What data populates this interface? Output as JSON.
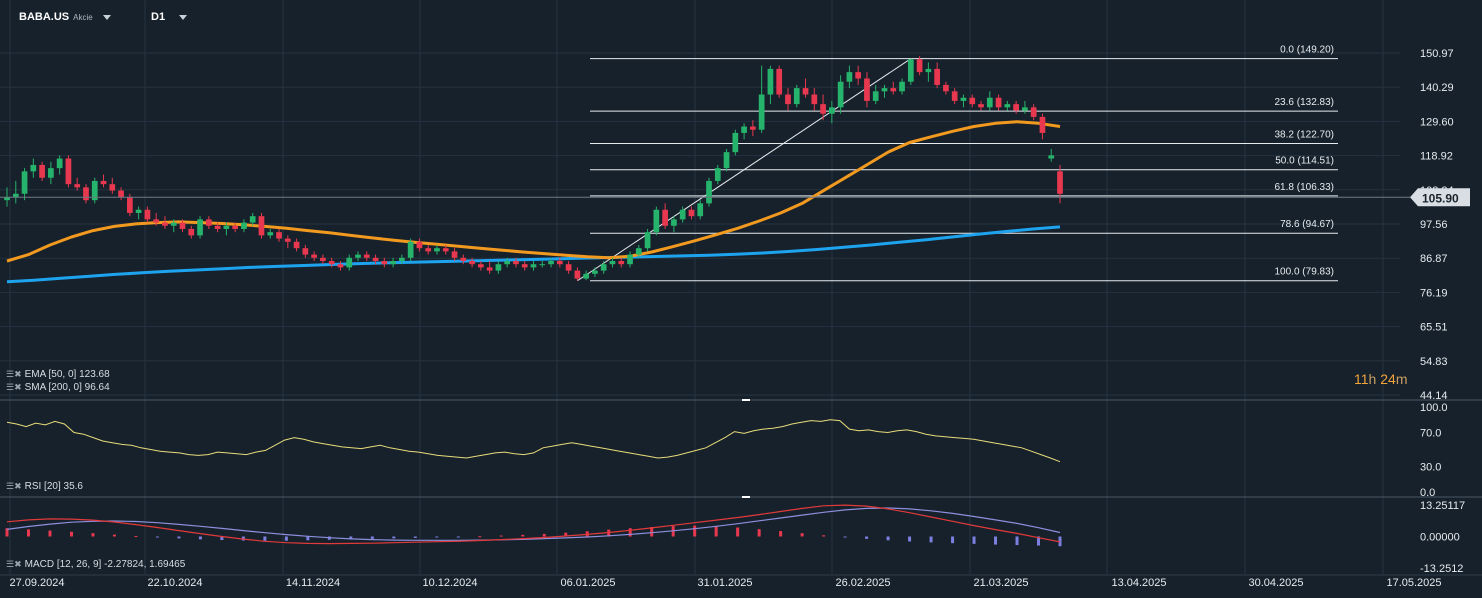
{
  "header": {
    "symbol": "BABA.US",
    "symbol_type": "Akcie",
    "timeframe": "D1"
  },
  "indicators": {
    "ema_label": "EMA [50, 0] 123.68",
    "sma_label": "SMA [200, 0] 96.64",
    "rsi_label": "RSI [20] 35.6",
    "macd_label": "MACD [12, 26, 9] -2.27824, 1.69465"
  },
  "countdown": {
    "hours": "11",
    "h_unit": "h",
    "minutes": "24",
    "m_unit": "m"
  },
  "colors": {
    "background": "#17212b",
    "grid": "#243240",
    "up_candle": "#26b36b",
    "down_candle": "#e8384f",
    "ema": "#f29a1f",
    "sma": "#1ea3ee",
    "rsi": "#e8dc7a",
    "macd_line": "#e23a3a",
    "signal_line": "#8c8fdd",
    "hist_pos": "#e8384f",
    "hist_neg": "#7b7fe0",
    "price_tag": "#d8dee3",
    "countdown": "#f2a33a"
  },
  "chart_data": [
    {
      "type": "candlestick",
      "price_axis_ticks": [
        "150.97",
        "140.29",
        "129.60",
        "118.92",
        "108.24",
        "97.56",
        "86.87",
        "76.19",
        "65.51",
        "54.83",
        "44.14"
      ],
      "ylim": [
        44.14,
        150.97
      ],
      "current_price": "105.90",
      "date_ticks": [
        "27.09.2024",
        "22.10.2024",
        "14.11.2024",
        "10.12.2024",
        "06.01.2025",
        "31.01.2025",
        "26.02.2025",
        "21.03.2025",
        "13.04.2025",
        "30.04.2025",
        "17.05.2025"
      ],
      "candles": [
        [
          105,
          109,
          103,
          106
        ],
        [
          106,
          111,
          104,
          107
        ],
        [
          107,
          115,
          105,
          114
        ],
        [
          114,
          118,
          112,
          116
        ],
        [
          116,
          117,
          111,
          112
        ],
        [
          112,
          117,
          110,
          115
        ],
        [
          115,
          119,
          113,
          118
        ],
        [
          118,
          119,
          109,
          110
        ],
        [
          110,
          112,
          108,
          109
        ],
        [
          109,
          110,
          104,
          105
        ],
        [
          105,
          112,
          104,
          111
        ],
        [
          111,
          113,
          109,
          110
        ],
        [
          110,
          112,
          107,
          108
        ],
        [
          108,
          109,
          105,
          106
        ],
        [
          106,
          107,
          100,
          101
        ],
        [
          101,
          103,
          99,
          102
        ],
        [
          102,
          103,
          98,
          99
        ],
        [
          99,
          101,
          97,
          98
        ],
        [
          98,
          100,
          96,
          97
        ],
        [
          97,
          99,
          95,
          98
        ],
        [
          98,
          99,
          95,
          96
        ],
        [
          96,
          97,
          93,
          94
        ],
        [
          94,
          100,
          93,
          99
        ],
        [
          99,
          100,
          96,
          97
        ],
        [
          97,
          98,
          95,
          96
        ],
        [
          96,
          98,
          94,
          97
        ],
        [
          97,
          98,
          95,
          96
        ],
        [
          96,
          99,
          95,
          98
        ],
        [
          98,
          101,
          97,
          100
        ],
        [
          100,
          101,
          93,
          94
        ],
        [
          94,
          96,
          93,
          95
        ],
        [
          95,
          96,
          92,
          93
        ],
        [
          93,
          94,
          90,
          92
        ],
        [
          92,
          93,
          89,
          90
        ],
        [
          90,
          91,
          87,
          88
        ],
        [
          88,
          89,
          86,
          87
        ],
        [
          87,
          88,
          85,
          86
        ],
        [
          86,
          87,
          84,
          85
        ],
        [
          85,
          86,
          83,
          84
        ],
        [
          84,
          88,
          83,
          87
        ],
        [
          87,
          89,
          86,
          88
        ],
        [
          88,
          89,
          86,
          87
        ],
        [
          87,
          88,
          85,
          86
        ],
        [
          86,
          87,
          84,
          85
        ],
        [
          85,
          87,
          84,
          86
        ],
        [
          86,
          88,
          85,
          87
        ],
        [
          87,
          93,
          86,
          92
        ],
        [
          92,
          93,
          89,
          90
        ],
        [
          90,
          91,
          88,
          89
        ],
        [
          89,
          91,
          88,
          90
        ],
        [
          90,
          91,
          88,
          89
        ],
        [
          89,
          90,
          86,
          87
        ],
        [
          87,
          88,
          85,
          86
        ],
        [
          86,
          87,
          84,
          85
        ],
        [
          85,
          86,
          83,
          84
        ],
        [
          84,
          86,
          82,
          83
        ],
        [
          83,
          86,
          82,
          85
        ],
        [
          85,
          87,
          84,
          86
        ],
        [
          86,
          87,
          84,
          85
        ],
        [
          85,
          86,
          83,
          84
        ],
        [
          84,
          86,
          83,
          85
        ],
        [
          85,
          86,
          84,
          85
        ],
        [
          85,
          87,
          84,
          86
        ],
        [
          86,
          87,
          84,
          85
        ],
        [
          85,
          86,
          82,
          83
        ],
        [
          83,
          84,
          79.83,
          80.5
        ],
        [
          80.5,
          83,
          80,
          82
        ],
        [
          82,
          84,
          81,
          83
        ],
        [
          83,
          86,
          82,
          85
        ],
        [
          85,
          87,
          84,
          86
        ],
        [
          86,
          87,
          84,
          85
        ],
        [
          85,
          89,
          84,
          88
        ],
        [
          88,
          91,
          87,
          90
        ],
        [
          90,
          96,
          89,
          95
        ],
        [
          95,
          103,
          94,
          102
        ],
        [
          102,
          104,
          96,
          97
        ],
        [
          97,
          100,
          95,
          99
        ],
        [
          99,
          103,
          98,
          102
        ],
        [
          102,
          103,
          99,
          100
        ],
        [
          100,
          105,
          99,
          104
        ],
        [
          104,
          112,
          103,
          111
        ],
        [
          111,
          116,
          110,
          115
        ],
        [
          115,
          121,
          114,
          120
        ],
        [
          120,
          127,
          119,
          126
        ],
        [
          126,
          129,
          124,
          128
        ],
        [
          128,
          130,
          125,
          127
        ],
        [
          127,
          147,
          126,
          138
        ],
        [
          138,
          147,
          135,
          146
        ],
        [
          146,
          147,
          137,
          138
        ],
        [
          138,
          140,
          133,
          135
        ],
        [
          135,
          141,
          134,
          140
        ],
        [
          140,
          143,
          137,
          138
        ],
        [
          138,
          140,
          133,
          135
        ],
        [
          135,
          138,
          130,
          132
        ],
        [
          132,
          136,
          129,
          134
        ],
        [
          134,
          144,
          132,
          142
        ],
        [
          142,
          147,
          140,
          145
        ],
        [
          145,
          147,
          141,
          143
        ],
        [
          143,
          145,
          134,
          136
        ],
        [
          136,
          141,
          135,
          139
        ],
        [
          139,
          141,
          137,
          140
        ],
        [
          140,
          142,
          138,
          139
        ],
        [
          139,
          143,
          138,
          142
        ],
        [
          142,
          149.2,
          141,
          149
        ],
        [
          149,
          150,
          144,
          145
        ],
        [
          145,
          148,
          142,
          146
        ],
        [
          146,
          148,
          140,
          141
        ],
        [
          141,
          142,
          138,
          139
        ],
        [
          139,
          140,
          135,
          136
        ],
        [
          136,
          138,
          134,
          137
        ],
        [
          137,
          138,
          134,
          135
        ],
        [
          135,
          136,
          133,
          134
        ],
        [
          134,
          139,
          133,
          137
        ],
        [
          137,
          138,
          133,
          134
        ],
        [
          134,
          136,
          133,
          135
        ],
        [
          135,
          136,
          132,
          133
        ],
        [
          133,
          136,
          132,
          134
        ],
        [
          134,
          135,
          130,
          131
        ],
        [
          131,
          132,
          124,
          126
        ],
        [
          118,
          121,
          117,
          119
        ],
        [
          114,
          116,
          104,
          107
        ]
      ],
      "ema50": [
        86,
        88,
        91,
        93.5,
        95.5,
        96.8,
        97.6,
        98,
        98.2,
        98,
        97.7,
        97.3,
        96.8,
        96.2,
        95.5,
        94.8,
        94,
        93.2,
        92.5,
        91.8,
        91.2,
        90.6,
        90,
        89.4,
        88.8,
        88.3,
        87.8,
        87.3,
        87,
        87.5,
        88.8,
        90.5,
        92.3,
        94.2,
        96.2,
        98.5,
        101,
        104,
        108,
        112,
        116,
        120,
        123,
        124.8,
        126.5,
        128,
        129,
        129.5,
        129,
        128
      ],
      "sma200": [
        79.5,
        80,
        80.6,
        81.2,
        81.8,
        82.3,
        82.8,
        83.2,
        83.6,
        84,
        84.3,
        84.6,
        84.9,
        85.2,
        85.4,
        85.6,
        85.8,
        86,
        86.2,
        86.4,
        86.6,
        86.8,
        87,
        87.2,
        87.4,
        87.6,
        87.8,
        88.1,
        88.5,
        89,
        89.6,
        90.3,
        91,
        91.8,
        92.6,
        93.5,
        94.4,
        95.2,
        96,
        96.64
      ],
      "fibonacci": [
        {
          "label": "0.0 (149.20)",
          "value": 149.2
        },
        {
          "label": "23.6 (132.83)",
          "value": 132.83
        },
        {
          "label": "38.2 (122.70)",
          "value": 122.7
        },
        {
          "label": "50.0 (114.51)",
          "value": 114.51
        },
        {
          "label": "61.8 (106.33)",
          "value": 106.33
        },
        {
          "label": "78.6 (94.67)",
          "value": 94.67
        },
        {
          "label": "100.0 (79.83)",
          "value": 79.83
        }
      ]
    },
    {
      "type": "line",
      "name": "RSI [20]",
      "price_axis_ticks": [
        "100.0",
        "70.0",
        "30.0",
        "0.0"
      ],
      "ylim": [
        0,
        100
      ],
      "values": [
        82,
        80,
        77,
        81,
        79,
        83,
        80,
        70,
        68,
        64,
        60,
        58,
        56,
        55,
        52,
        50,
        48,
        47,
        46,
        44,
        43,
        44,
        47,
        46,
        45,
        44,
        47,
        49,
        55,
        61,
        64,
        62,
        59,
        57,
        55,
        53,
        52,
        51,
        53,
        55,
        52,
        50,
        48,
        47,
        45,
        43,
        42,
        41,
        40,
        42,
        44,
        46,
        47,
        45,
        44,
        46,
        52,
        54,
        56,
        58,
        56,
        54,
        52,
        50,
        48,
        46,
        44,
        42,
        40,
        41,
        43,
        46,
        49,
        52,
        58,
        64,
        71,
        69,
        72,
        74,
        75,
        77,
        80,
        82,
        84,
        83,
        85,
        84,
        74,
        72,
        73,
        71,
        70,
        72,
        73,
        71,
        68,
        66,
        65,
        64,
        63,
        62,
        60,
        58,
        56,
        54,
        52,
        48,
        44,
        40,
        35.6
      ],
      "current_label": "35.6"
    },
    {
      "type": "bar+line",
      "name": "MACD [12, 26, 9]",
      "price_axis_ticks": [
        "13.25117",
        "0.00000",
        "-13.2512"
      ],
      "ylim": [
        -13.2512,
        13.25117
      ],
      "histogram": [
        3.5,
        3,
        2.5,
        2,
        1.4,
        0.8,
        0.2,
        -0.3,
        -0.8,
        -1.2,
        -1.5,
        -1.7,
        -1.8,
        -1.8,
        -1.6,
        -1.4,
        -1.2,
        -1,
        -0.8,
        -0.6,
        -0.4,
        -0.2,
        0.1,
        0.4,
        0.7,
        1.1,
        1.6,
        2.2,
        2.9,
        3.5,
        4,
        4.4,
        4.6,
        4.3,
        3.8,
        3.1,
        2.3,
        1.4,
        0.5,
        -0.3,
        -1,
        -1.6,
        -2.1,
        -2.5,
        -2.8,
        -3.1,
        -3.4,
        -3.6,
        -3.8,
        -4.1
      ],
      "macd_line": [
        6.2,
        7,
        7.4,
        7.3,
        6.9,
        6.1,
        5,
        3.8,
        2.5,
        1.2,
        0,
        -1.1,
        -2,
        -2.6,
        -2.9,
        -3,
        -2.9,
        -2.8,
        -2.6,
        -2.4,
        -2.2,
        -2,
        -1.7,
        -1.3,
        -0.9,
        -0.4,
        0.2,
        0.9,
        1.7,
        2.6,
        3.6,
        4.7,
        5.8,
        6.9,
        8,
        9.2,
        10.5,
        11.8,
        12.9,
        13.2,
        12.8,
        11.6,
        10,
        8.2,
        6.4,
        4.6,
        2.9,
        1.3,
        -0.5,
        -2.28
      ],
      "signal_line": [
        3,
        4.2,
        5.2,
        6,
        6.4,
        6.5,
        6.3,
        5.8,
        5.1,
        4.3,
        3.4,
        2.5,
        1.6,
        0.8,
        0.1,
        -0.5,
        -1,
        -1.3,
        -1.5,
        -1.6,
        -1.6,
        -1.6,
        -1.5,
        -1.4,
        -1.2,
        -0.9,
        -0.6,
        -0.2,
        0.3,
        0.9,
        1.6,
        2.4,
        3.3,
        4.3,
        5.4,
        6.6,
        7.8,
        9,
        10.2,
        11.2,
        11.8,
        12,
        11.6,
        10.8,
        9.7,
        8.4,
        7,
        5.5,
        3.7,
        1.69
      ]
    }
  ]
}
